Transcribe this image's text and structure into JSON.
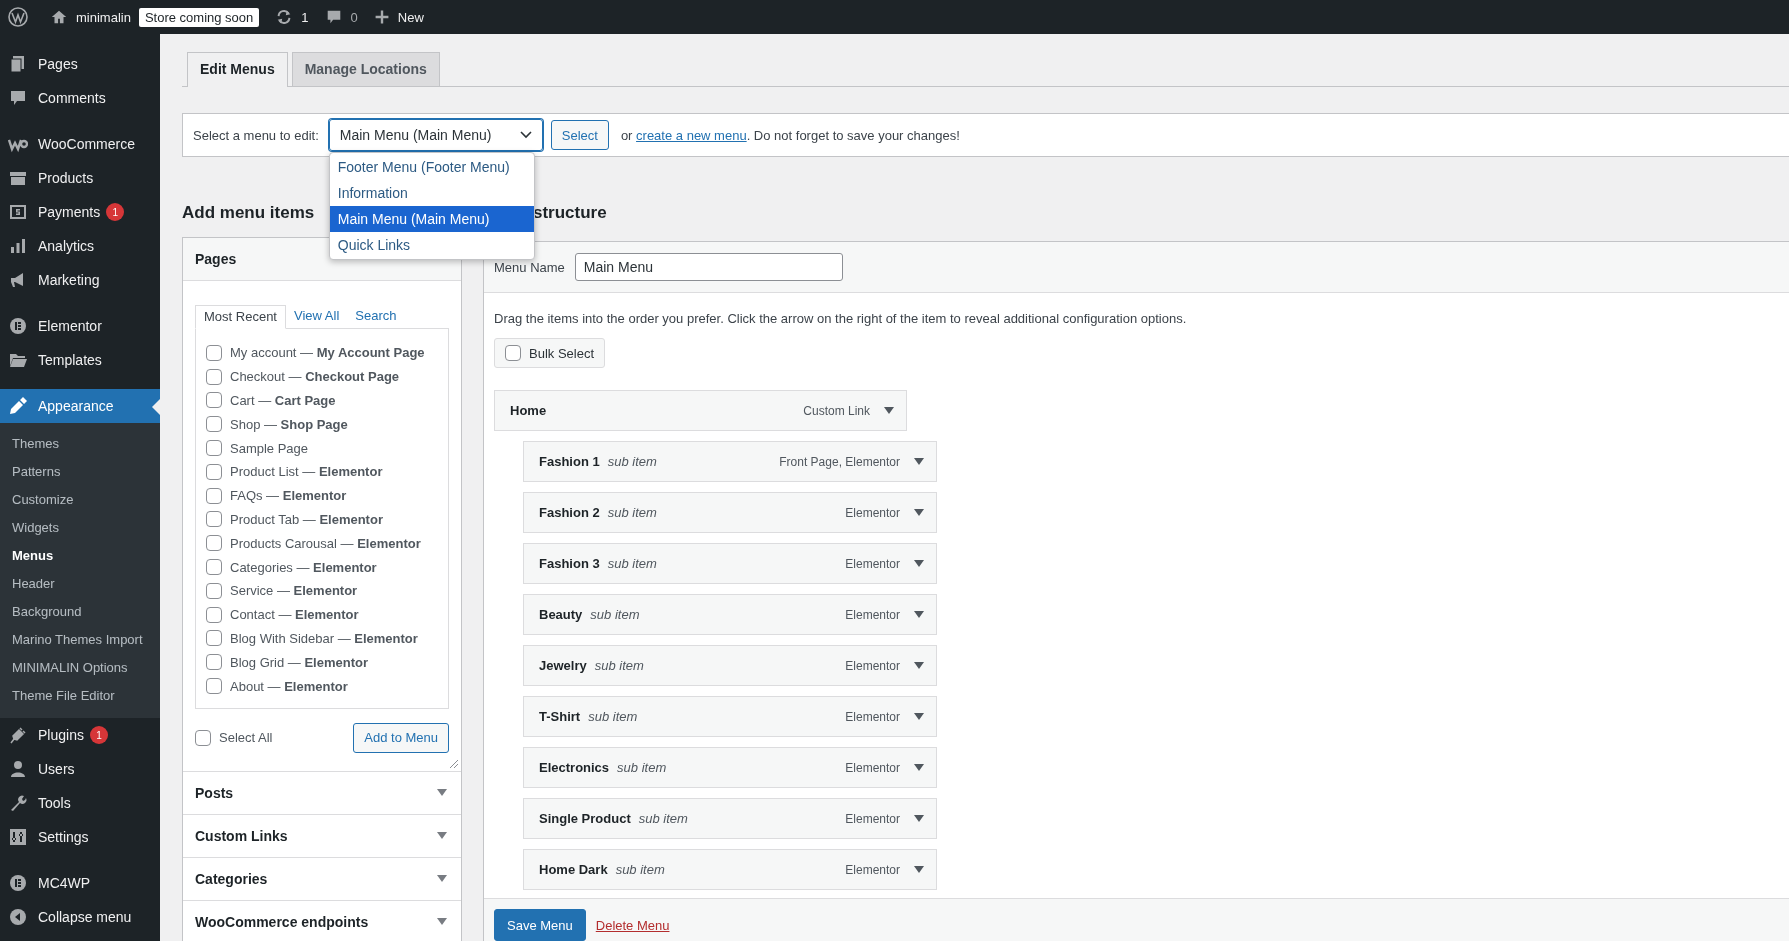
{
  "admin_bar": {
    "site": "minimalin",
    "badge": "Store coming soon",
    "updates": "1",
    "comments": "0",
    "new": "New"
  },
  "sidebar": {
    "groups": [
      {
        "items": [
          {
            "label": "Pages",
            "selected": false
          },
          {
            "label": "Comments",
            "selected": false
          }
        ]
      },
      {
        "items": [
          {
            "label": "WooCommerce",
            "selected": false
          },
          {
            "label": "Products",
            "selected": false
          },
          {
            "label": "Payments",
            "selected": false,
            "badge": "1"
          },
          {
            "label": "Analytics",
            "selected": false
          },
          {
            "label": "Marketing",
            "selected": false
          }
        ]
      },
      {
        "items": [
          {
            "label": "Elementor",
            "selected": false
          },
          {
            "label": "Templates",
            "selected": false
          }
        ]
      },
      {
        "items": [
          {
            "label": "Appearance",
            "selected": true,
            "submenu": [
              {
                "label": "Themes",
                "selected": false
              },
              {
                "label": "Patterns",
                "selected": false
              },
              {
                "label": "Customize",
                "selected": false
              },
              {
                "label": "Widgets",
                "selected": false
              },
              {
                "label": "Menus",
                "selected": true
              },
              {
                "label": "Header",
                "selected": false
              },
              {
                "label": "Background",
                "selected": false
              },
              {
                "label": "Marino Themes Import",
                "selected": false
              },
              {
                "label": "MINIMALIN Options",
                "selected": false
              },
              {
                "label": "Theme File Editor",
                "selected": false
              }
            ]
          },
          {
            "label": "Plugins",
            "selected": false,
            "badge": "1"
          },
          {
            "label": "Users",
            "selected": false
          },
          {
            "label": "Tools",
            "selected": false
          },
          {
            "label": "Settings",
            "selected": false
          }
        ]
      },
      {
        "items": [
          {
            "label": "MC4WP",
            "selected": false
          },
          {
            "label": "Collapse menu",
            "selected": false
          }
        ]
      }
    ]
  },
  "tabs": [
    {
      "label": "Edit Menus",
      "selected": true
    },
    {
      "label": "Manage Locations",
      "selected": false
    }
  ],
  "menu_select": {
    "label": "Select a menu to edit:",
    "value": "Main Menu (Main Menu)",
    "button": "Select",
    "note_prefix": "or",
    "link": "create a new menu",
    "note_suffix": ". Do not forget to save your changes!",
    "options": [
      {
        "label": "Footer Menu (Footer Menu)",
        "selected": false
      },
      {
        "label": "Information",
        "selected": false
      },
      {
        "label": "Main Menu (Main Menu)",
        "selected": true
      },
      {
        "label": "Quick Links",
        "selected": false
      }
    ]
  },
  "add_items": {
    "heading": "Add menu items",
    "sections": [
      {
        "title": "Pages",
        "expanded": true,
        "tabs": [
          {
            "label": "Most Recent",
            "selected": true
          },
          {
            "label": "View All",
            "selected": false
          },
          {
            "label": "Search",
            "selected": false
          }
        ],
        "pages": [
          {
            "label": "My account — **My Account Page**",
            "checked": false
          },
          {
            "label": "Checkout — **Checkout Page**",
            "checked": false
          },
          {
            "label": "Cart — **Cart Page**",
            "checked": false
          },
          {
            "label": "Shop — **Shop Page**",
            "checked": false
          },
          {
            "label": "Sample Page",
            "checked": false
          },
          {
            "label": "Product List — **Elementor**",
            "checked": false
          },
          {
            "label": "FAQs — **Elementor**",
            "checked": false
          },
          {
            "label": "Product Tab — **Elementor**",
            "checked": false
          },
          {
            "label": "Products Carousal — **Elementor**",
            "checked": false
          },
          {
            "label": "Categories — **Elementor**",
            "checked": false
          },
          {
            "label": "Service — **Elementor**",
            "checked": false
          },
          {
            "label": "Contact — **Elementor**",
            "checked": false
          },
          {
            "label": "Blog With Sidebar — **Elementor**",
            "checked": false
          },
          {
            "label": "Blog Grid — **Elementor**",
            "checked": false
          },
          {
            "label": "About — **Elementor**",
            "checked": false
          }
        ],
        "select_all": {
          "label": "Select All",
          "checked": false
        },
        "button": "Add to Menu"
      },
      {
        "title": "Posts",
        "expanded": false
      },
      {
        "title": "Custom Links",
        "expanded": false
      },
      {
        "title": "Categories",
        "expanded": false
      },
      {
        "title": "WooCommerce endpoints",
        "expanded": false
      }
    ]
  },
  "structure": {
    "heading": "structure",
    "name_label": "Menu Name",
    "name_value": "Main Menu",
    "instructions": "Drag the items into the order you prefer. Click the arrow on the right of the item to reveal additional configuration options.",
    "bulk_select": {
      "label": "Bulk Select",
      "checked": false
    },
    "items": [
      {
        "title": "Home",
        "type": "Custom Link",
        "children": [
          {
            "title": "Fashion 1",
            "note": "sub item",
            "type": "Front Page, Elementor"
          },
          {
            "title": "Fashion 2",
            "note": "sub item",
            "type": "Elementor"
          },
          {
            "title": "Fashion 3",
            "note": "sub item",
            "type": "Elementor"
          },
          {
            "title": "Beauty",
            "note": "sub item",
            "type": "Elementor"
          },
          {
            "title": "Jewelry",
            "note": "sub item",
            "type": "Elementor"
          },
          {
            "title": "T-Shirt",
            "note": "sub item",
            "type": "Elementor"
          },
          {
            "title": "Electronics",
            "note": "sub item",
            "type": "Elementor"
          },
          {
            "title": "Single Product",
            "note": "sub item",
            "type": "Elementor"
          },
          {
            "title": "Home Dark",
            "note": "sub item",
            "type": "Elementor"
          }
        ]
      }
    ],
    "save": "Save Menu",
    "delete": "Delete Menu"
  }
}
